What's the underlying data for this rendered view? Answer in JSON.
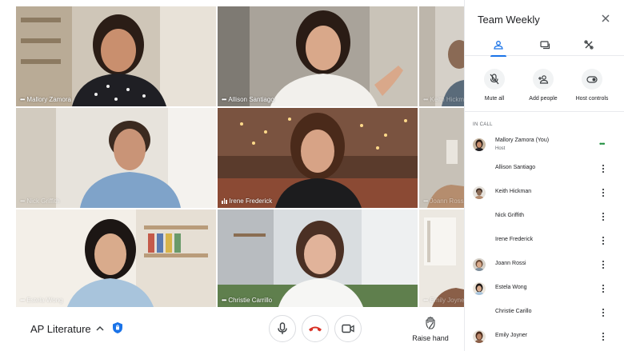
{
  "tiles": [
    {
      "name": "Mallory Zamora",
      "indicator": "dots",
      "faded": false
    },
    {
      "name": "Allison Santiago",
      "indicator": "dots",
      "faded": false
    },
    {
      "name": "Keith Hickman",
      "indicator": "dots",
      "faded": true
    },
    {
      "name": "Nick Griffith",
      "indicator": "dots",
      "faded": true
    },
    {
      "name": "Irene Frederick",
      "indicator": "bars",
      "faded": false
    },
    {
      "name": "Joann Rossi",
      "indicator": "dots",
      "faded": true
    },
    {
      "name": "Estela Wong",
      "indicator": "dots",
      "faded": true
    },
    {
      "name": "Christie Carrillo",
      "indicator": "dots",
      "faded": false
    },
    {
      "name": "Emily Joyner",
      "indicator": "dots",
      "faded": true
    }
  ],
  "bottom_bar": {
    "meeting_name": "AP Literature",
    "chevron_icon": "chevron-up-icon",
    "controls": [
      "mic-icon",
      "end-call-icon",
      "camera-icon"
    ],
    "end_call_color": "#d93025",
    "raise_hand_label": "Raise hand"
  },
  "panel": {
    "title": "Team Weekly",
    "tabs": [
      "people-icon",
      "chat-icon",
      "activities-icon"
    ],
    "active_tab": 0,
    "actions": [
      {
        "label": "Mute all",
        "icon": "mute-all-icon"
      },
      {
        "label": "Add people",
        "icon": "add-person-icon"
      },
      {
        "label": "Host controls",
        "icon": "host-controls-icon"
      }
    ],
    "section_label": "IN CALL",
    "accent_color": "#1a73e8",
    "people": [
      {
        "name": "Mallory Zamora (You)",
        "sub": "Host",
        "has_avatar": true,
        "speaking": true
      },
      {
        "name": "Allison Santiago",
        "sub": "",
        "has_avatar": false,
        "speaking": false
      },
      {
        "name": "Keith Hickman",
        "sub": "",
        "has_avatar": true,
        "speaking": false
      },
      {
        "name": "Nick Griffith",
        "sub": "",
        "has_avatar": false,
        "speaking": false
      },
      {
        "name": "Irene Frederick",
        "sub": "",
        "has_avatar": false,
        "speaking": false
      },
      {
        "name": "Joann Rossi",
        "sub": "",
        "has_avatar": true,
        "speaking": false
      },
      {
        "name": "Estela Wong",
        "sub": "",
        "has_avatar": true,
        "speaking": false
      },
      {
        "name": "Christie Carillo",
        "sub": "",
        "has_avatar": false,
        "speaking": false
      },
      {
        "name": "Emily Joyner",
        "sub": "",
        "has_avatar": true,
        "speaking": false
      }
    ]
  }
}
